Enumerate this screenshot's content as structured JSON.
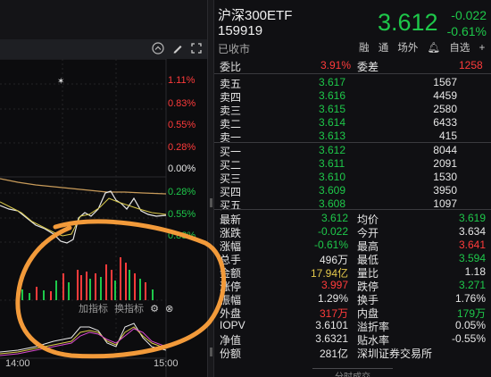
{
  "chart": {
    "pct_labels": [
      {
        "text": "1.11%",
        "color": "#ff3b3b"
      },
      {
        "text": "0.83%",
        "color": "#ff3b3b"
      },
      {
        "text": "0.55%",
        "color": "#ff3b3b"
      },
      {
        "text": "0.28%",
        "color": "#ff3b3b"
      },
      {
        "text": "0.00%",
        "color": "#e6e6e6"
      },
      {
        "text": "0.28%",
        "color": "#1ec84a"
      },
      {
        "text": "0.55%",
        "color": "#1ec84a"
      },
      {
        "text": "0.83%",
        "color": "#1ec84a"
      }
    ],
    "time_labels": [
      "14:00",
      "15:00"
    ],
    "indicator_bar": {
      "add_label": "加指标",
      "switch_label": "换指标",
      "gear_icon": "gear-icon",
      "close_icon": "close-circle-icon"
    },
    "toolbar_icons": [
      "chevron-up-circle-icon",
      "pen-icon",
      "expand-icon"
    ]
  },
  "quote": {
    "name": "沪深300ETF",
    "code": "159919",
    "last": "3.612",
    "change": "-0.022",
    "change_pct": "-0.61%",
    "status": "已收市",
    "tags": [
      "融",
      "通",
      "场外"
    ],
    "bell_icon": "bell-icon",
    "self_pick": "自选",
    "plus_icon": "plus-icon",
    "menu_icon": "menu-icon",
    "ratio": {
      "label": "委比",
      "value": "3.91%",
      "diff_label": "委差",
      "diff_value": "1258"
    },
    "asks": [
      {
        "label": "卖五",
        "price": "3.617",
        "vol": "1567"
      },
      {
        "label": "卖四",
        "price": "3.616",
        "vol": "4459"
      },
      {
        "label": "卖三",
        "price": "3.615",
        "vol": "2580"
      },
      {
        "label": "卖二",
        "price": "3.614",
        "vol": "6433"
      },
      {
        "label": "卖一",
        "price": "3.613",
        "vol": "415"
      }
    ],
    "bids": [
      {
        "label": "买一",
        "price": "3.612",
        "vol": "8044"
      },
      {
        "label": "买二",
        "price": "3.611",
        "vol": "2091"
      },
      {
        "label": "买三",
        "price": "3.610",
        "vol": "1530"
      },
      {
        "label": "买四",
        "price": "3.609",
        "vol": "3950"
      },
      {
        "label": "买五",
        "price": "3.608",
        "vol": "1097"
      }
    ],
    "stats": [
      {
        "l1": "最新",
        "v1": "3.612",
        "c1": "green",
        "l2": "均价",
        "v2": "3.619",
        "c2": "green"
      },
      {
        "l1": "涨跌",
        "v1": "-0.022",
        "c1": "green",
        "l2": "今开",
        "v2": "3.634",
        "c2": "white"
      },
      {
        "l1": "涨幅",
        "v1": "-0.61%",
        "c1": "green",
        "l2": "最高",
        "v2": "3.641",
        "c2": "red"
      },
      {
        "l1": "总手",
        "v1": "496万",
        "c1": "white",
        "l2": "最低",
        "v2": "3.594",
        "c2": "green"
      },
      {
        "l1": "金额",
        "v1": "17.94亿",
        "c1": "yellow",
        "l2": "量比",
        "v2": "1.18",
        "c2": "white"
      },
      {
        "l1": "涨停",
        "v1": "3.997",
        "c1": "red",
        "l2": "跌停",
        "v2": "3.271",
        "c2": "green"
      },
      {
        "l1": "振幅",
        "v1": "1.29%",
        "c1": "white",
        "l2": "换手",
        "v2": "1.76%",
        "c2": "white"
      },
      {
        "l1": "外盘",
        "v1": "317万",
        "c1": "red",
        "l2": "内盘",
        "v2": "179万",
        "c2": "green"
      },
      {
        "l1": "IOPV",
        "v1": "3.6101",
        "c1": "white",
        "l2": "溢折率",
        "v2": "0.05%",
        "c2": "white"
      },
      {
        "l1": "净值",
        "v1": "3.6321",
        "c1": "white",
        "l2": "贴水率",
        "v2": "-0.55%",
        "c2": "white"
      },
      {
        "l1": "份额",
        "v1": "281亿",
        "c1": "white",
        "l2": "深圳证券交易所",
        "v2": "",
        "c2": "white"
      }
    ],
    "trade_tab": "分时成交"
  },
  "colors": {
    "up": "#ff3b3b",
    "down": "#1ec84a",
    "accent": "#f29a3a",
    "bg": "#101013"
  }
}
